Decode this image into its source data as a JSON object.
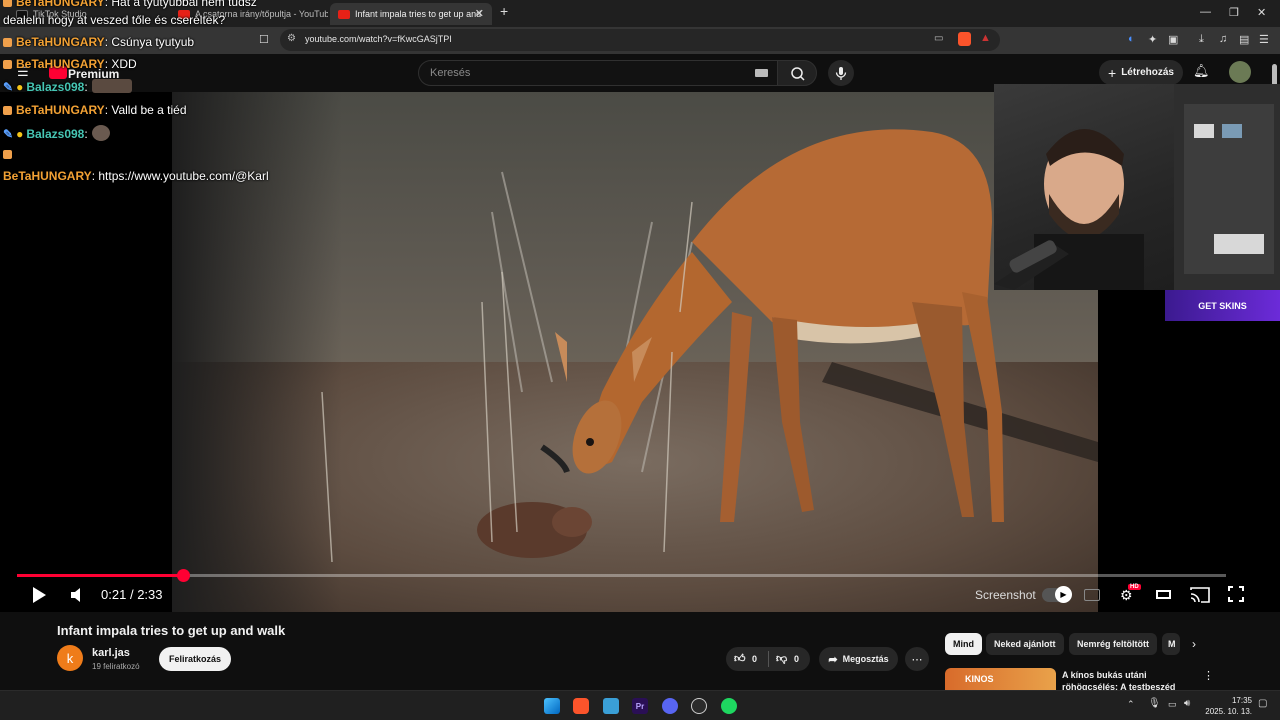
{
  "browser": {
    "tabs": [
      {
        "label": "TikTok Studio",
        "active": false
      },
      {
        "label": "A csatorna irány/tőpultja - YouTube S",
        "active": false
      },
      {
        "label": "Infant impala tries to get up and",
        "active": true
      }
    ],
    "url": "youtube.com/watch?v=fKwcGASjTPI"
  },
  "youtube": {
    "logo_text": "Premium",
    "search_placeholder": "Keresés",
    "create_label": "Létrehozás"
  },
  "chat": [
    {
      "user": "BeTaHUNGARY",
      "msg": ": Hát a tyutyubbal nem tudsz"
    },
    {
      "user": "",
      "msg": "dealelni hogy át veszed tőle és cseréltek?"
    },
    {
      "user": "BeTaHUNGARY",
      "msg": ": Csúnya tyutyub"
    },
    {
      "user": "BeTaHUNGARY",
      "msg": ": XDD"
    },
    {
      "user": "Balazs098",
      "msg": ":"
    },
    {
      "user": "BeTaHUNGARY",
      "msg": ": Valld be a tiéd"
    },
    {
      "user": "Balazs098",
      "msg": ":"
    },
    {
      "user": "BeTaHUNGARY",
      "msg": ": https://www.youtube.com/@Karl"
    }
  ],
  "overlay": {
    "getskins": "GET SKINS"
  },
  "player": {
    "current_time": "0:21",
    "separator": "/",
    "duration": "2:33",
    "progress_fraction": 0.137,
    "screenshot_label": "Screenshot"
  },
  "video": {
    "title": "Infant impala tries to get up and walk",
    "channel_initial": "k",
    "channel_name": "karl.jas",
    "subscribers": "19 feliratkozó",
    "subscribe_label": "Feliratkozás",
    "likes": "0",
    "dislikes": "0",
    "share_label": "Megosztás"
  },
  "chips": [
    "Mind",
    "Neked ajánlott",
    "Nemrég feltöltött",
    "M"
  ],
  "recommended": {
    "title": "A kínos bukás utáni röhögcsélés: A testbeszéd",
    "thumb_text": "KINOS"
  },
  "taskbar": {
    "time": "17:35",
    "date": "2025. 10. 13."
  },
  "colors": {
    "accent": "#ff0033",
    "chat_user": "#f2a134",
    "chat_user_alt": "#46c6b4"
  }
}
